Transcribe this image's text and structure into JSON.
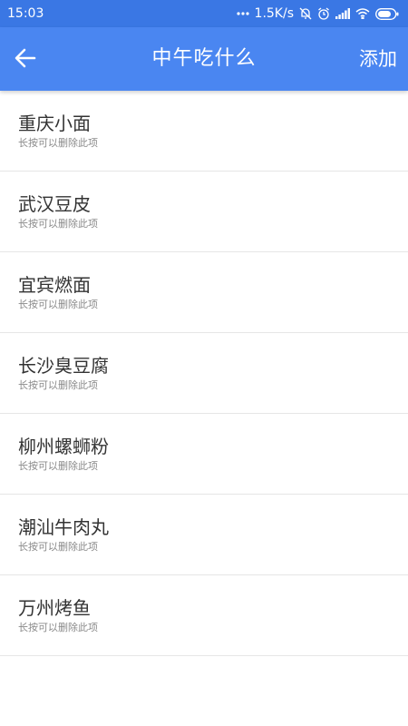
{
  "status_bar": {
    "time": "15:03",
    "network_speed": "1.5K/s",
    "icons": [
      "more-dots-icon",
      "mute-bell-icon",
      "alarm-clock-icon",
      "signal-icon",
      "wifi-icon",
      "battery-icon"
    ]
  },
  "app_bar": {
    "back_icon": "arrow-left-icon",
    "title": "中午吃什么",
    "action_label": "添加"
  },
  "list": {
    "items": [
      {
        "title": "重庆小面",
        "hint": "长按可以删除此项"
      },
      {
        "title": "武汉豆皮",
        "hint": "长按可以删除此项"
      },
      {
        "title": "宜宾燃面",
        "hint": "长按可以删除此项"
      },
      {
        "title": "长沙臭豆腐",
        "hint": "长按可以删除此项"
      },
      {
        "title": "柳州螺蛳粉",
        "hint": "长按可以删除此项"
      },
      {
        "title": "潮汕牛肉丸",
        "hint": "长按可以删除此项"
      },
      {
        "title": "万州烤鱼",
        "hint": "长按可以删除此项"
      }
    ]
  },
  "colors": {
    "status_bar_bg": "#3a77e4",
    "app_bar_bg": "#4a86f1",
    "item_title": "#333333",
    "item_hint": "#8a8a8a",
    "divider": "#e6e6e6"
  }
}
